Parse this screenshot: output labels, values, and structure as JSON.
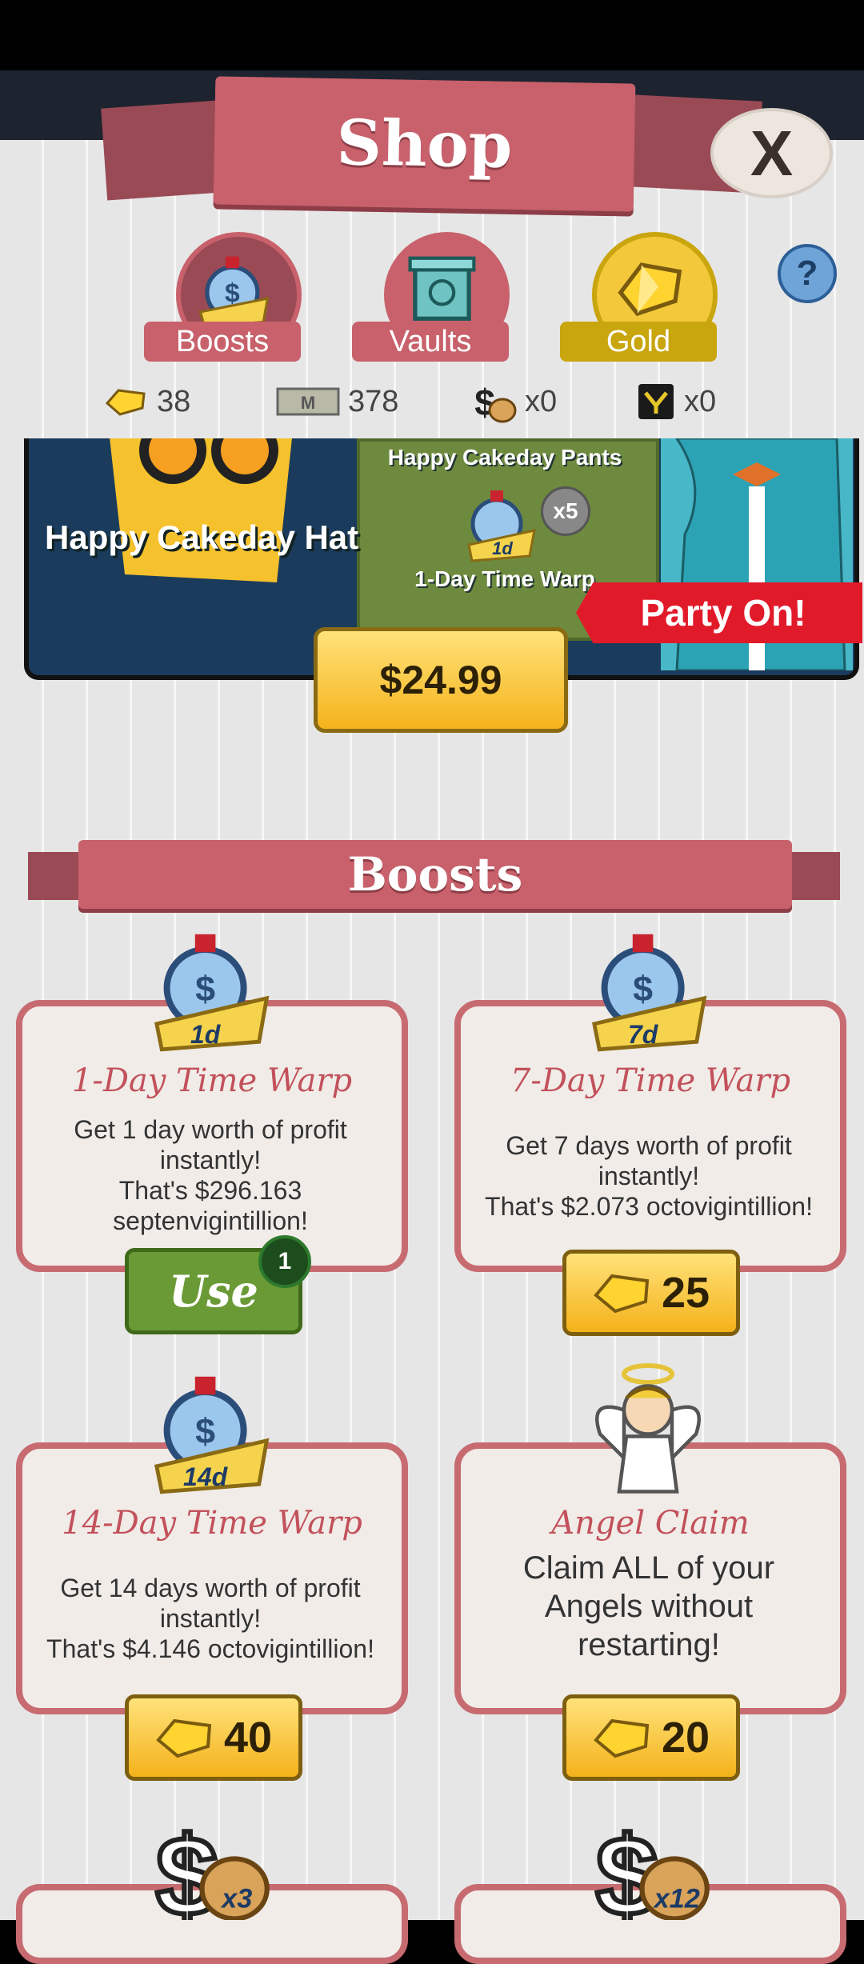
{
  "header": {
    "title": "Shop",
    "close_label": "X",
    "help_label": "?"
  },
  "tabs": [
    {
      "label": "Boosts",
      "icon": "stopwatch-icon",
      "color": "#c8616b",
      "circle": "#9a4a55"
    },
    {
      "label": "Vaults",
      "icon": "vault-icon",
      "color": "#c8616b",
      "circle": "#c8616b"
    },
    {
      "label": "Gold",
      "icon": "gold-icon",
      "color": "#c9a50e",
      "circle": "#e0b317"
    }
  ],
  "currencies": [
    {
      "icon": "gold-icon",
      "value": "38"
    },
    {
      "icon": "megabucks-icon",
      "value": "378"
    },
    {
      "icon": "money-bag-icon",
      "value": "x0"
    },
    {
      "icon": "badge-icon",
      "value": "x0"
    }
  ],
  "featured": {
    "hat_label": "Happy Cakeday Hat",
    "pants_label": "Happy Cakeday Pants",
    "warp_label": "1-Day Time Warp",
    "warp_badge": "1d",
    "warp_count": "x5",
    "flag": "Party On!",
    "price": "$24.99"
  },
  "section": {
    "title": "Boosts"
  },
  "cards": [
    {
      "title": "1-Day Time Warp",
      "icon_label": "1d",
      "description": "Get 1 day worth of profit instantly!\nThat's $296.163 septenvigintillion!",
      "action": "Use",
      "badge": "1"
    },
    {
      "title": "7-Day Time Warp",
      "icon_label": "7d",
      "description": "Get 7 days worth of profit instantly!\nThat's $2.073 octovigintillion!",
      "price": "25"
    },
    {
      "title": "14-Day Time Warp",
      "icon_label": "14d",
      "description": "Get 14 days worth of profit instantly!\nThat's $4.146 octovigintillion!",
      "price": "40"
    },
    {
      "title": "Angel Claim",
      "description": "Claim ALL of your Angels without restarting!",
      "price": "20"
    }
  ],
  "bottom_items": [
    {
      "icon_label": "x3"
    },
    {
      "icon_label": "x12"
    }
  ]
}
